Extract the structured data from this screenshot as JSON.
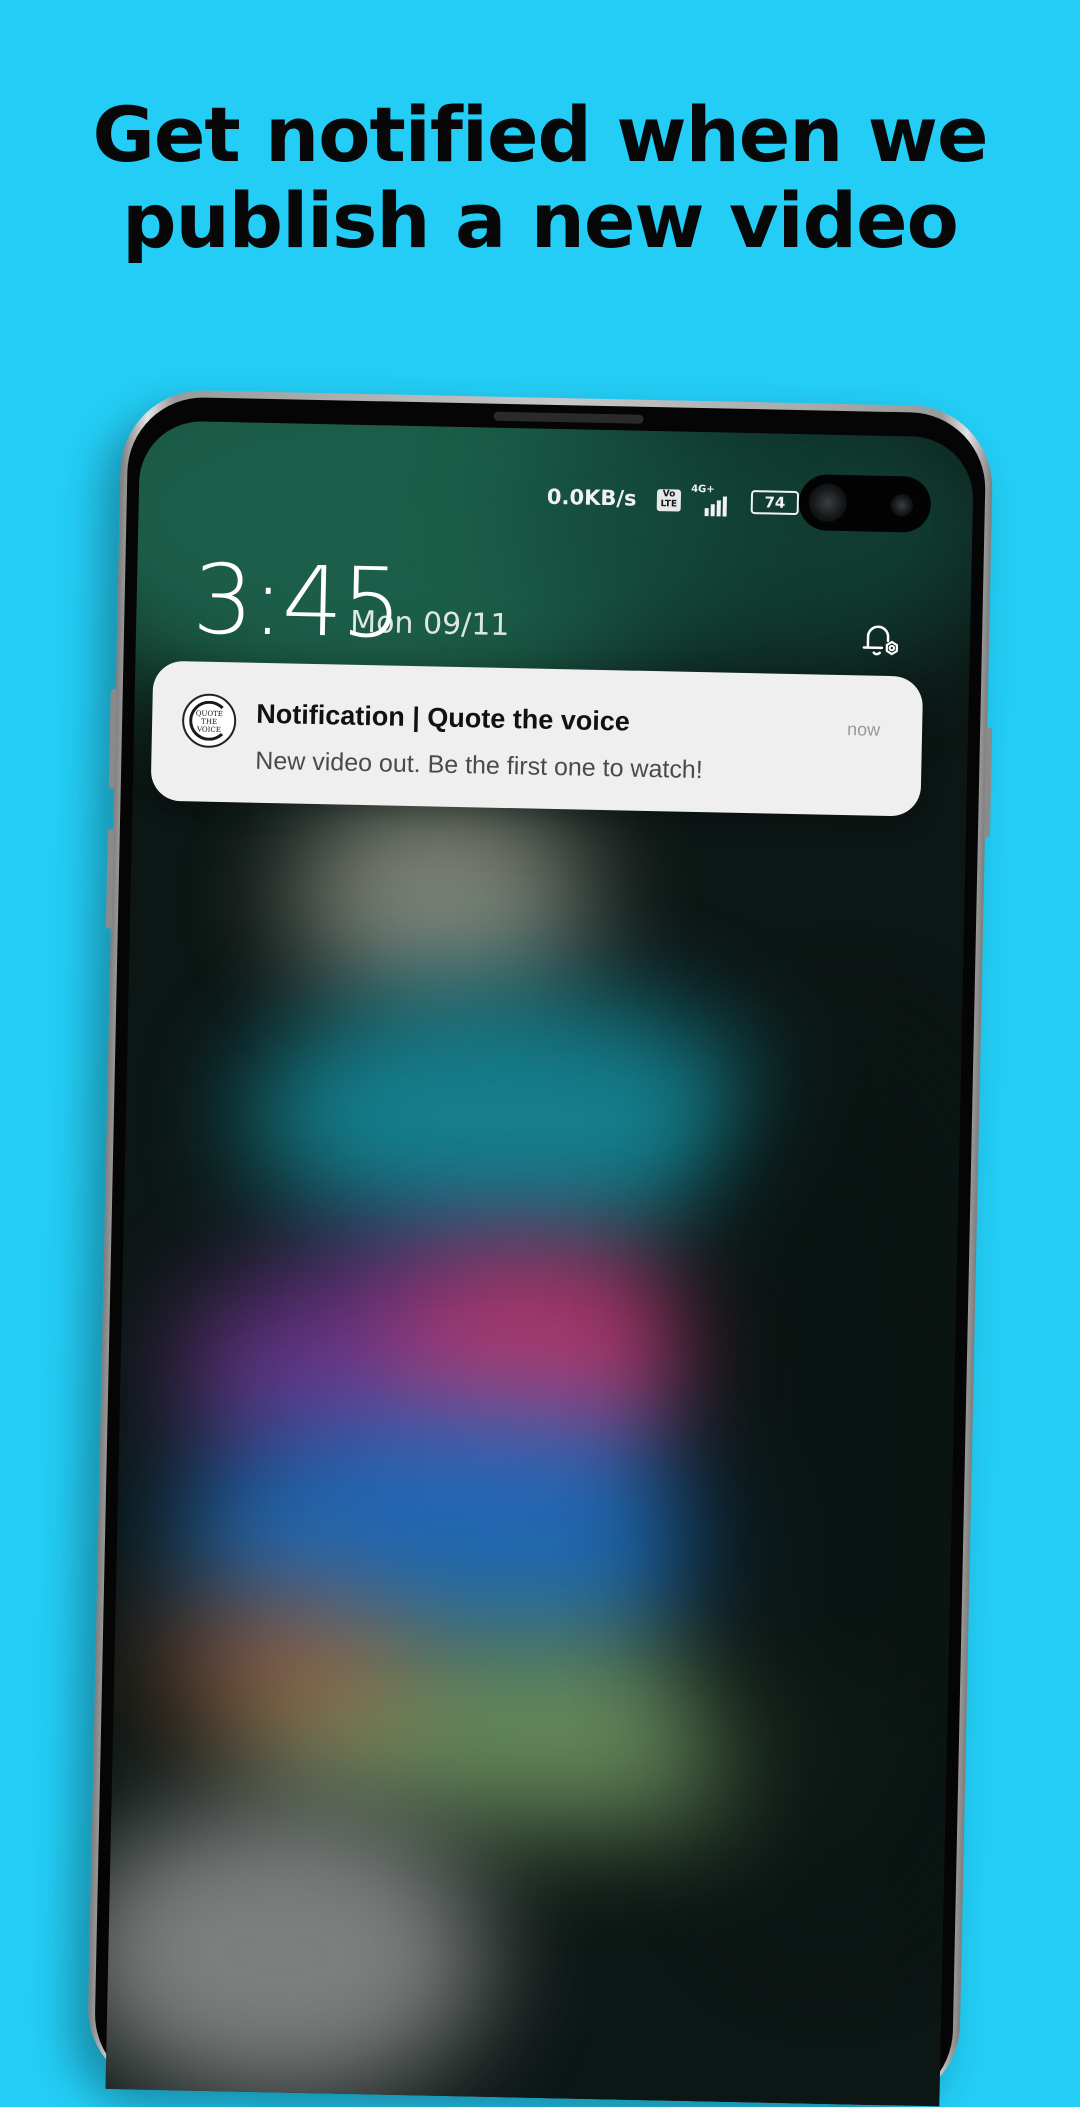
{
  "headline": {
    "line1": "Get notified when we",
    "line2": "publish a new video"
  },
  "status_bar": {
    "network_speed": "0.0KB/s",
    "volte_label": "Vo LTE",
    "network_type": "4G+",
    "battery_level": "74"
  },
  "lockscreen": {
    "time": "3:45",
    "date": "Mon 09/11"
  },
  "notification": {
    "title": "Notification | Quote the voice",
    "body": "New video out. Be the first one to watch!",
    "time": "now",
    "app_icon": "quote-the-voice-logo"
  },
  "colors": {
    "background": "#23cdf5",
    "headline_text": "#080808",
    "notification_card": "#efefef"
  }
}
